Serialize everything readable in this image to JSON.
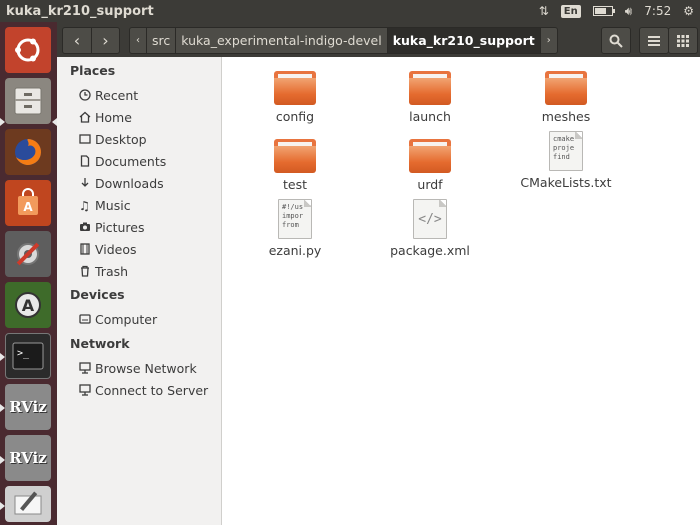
{
  "window": {
    "title": "kuka_kr210_support"
  },
  "top_panel": {
    "language": "En",
    "time": "7:52",
    "battery_level": 0.7
  },
  "launcher": {
    "items": [
      {
        "name": "dash-home",
        "icon": "ubuntu-logo-icon",
        "color": "#e95420"
      },
      {
        "name": "files",
        "icon": "file-cabinet-icon",
        "color": "#b7b5b0"
      },
      {
        "name": "firefox",
        "icon": "firefox-icon",
        "color": "#e66000"
      },
      {
        "name": "software-center",
        "icon": "shopping-bag-icon",
        "color": "#e95420"
      },
      {
        "name": "system-settings",
        "icon": "wrench-gear-icon",
        "color": "#9a9a9a"
      },
      {
        "name": "update-manager",
        "icon": "update-icon",
        "color": "#5a8f3a"
      },
      {
        "name": "terminal",
        "icon": "terminal-icon",
        "color": "#2b2b2b"
      },
      {
        "name": "rviz-1",
        "icon": "rviz-icon",
        "label": "RViz",
        "color": "#8c8c8c"
      },
      {
        "name": "rviz-2",
        "icon": "rviz-icon",
        "label": "RViz",
        "color": "#8c8c8c"
      },
      {
        "name": "text-editor",
        "icon": "pencil-icon",
        "color": "#cfcfcf"
      }
    ]
  },
  "toolbar": {
    "breadcrumbs": [
      {
        "label": "src",
        "active": false
      },
      {
        "label": "kuka_experimental-indigo-devel",
        "active": false
      },
      {
        "label": "kuka_kr210_support",
        "active": true
      }
    ]
  },
  "sidebar": {
    "places_title": "Places",
    "places": [
      {
        "label": "Recent",
        "icon": "clock-icon"
      },
      {
        "label": "Home",
        "icon": "home-icon"
      },
      {
        "label": "Desktop",
        "icon": "folder-icon"
      },
      {
        "label": "Documents",
        "icon": "document-icon"
      },
      {
        "label": "Downloads",
        "icon": "download-icon"
      },
      {
        "label": "Music",
        "icon": "music-note-icon"
      },
      {
        "label": "Pictures",
        "icon": "camera-icon"
      },
      {
        "label": "Videos",
        "icon": "film-icon"
      },
      {
        "label": "Trash",
        "icon": "trash-icon"
      }
    ],
    "devices_title": "Devices",
    "devices": [
      {
        "label": "Computer",
        "icon": "drive-icon"
      }
    ],
    "network_title": "Network",
    "network": [
      {
        "label": "Browse Network",
        "icon": "network-icon"
      },
      {
        "label": "Connect to Server",
        "icon": "server-icon"
      }
    ]
  },
  "files": [
    {
      "name": "config",
      "type": "folder"
    },
    {
      "name": "launch",
      "type": "folder"
    },
    {
      "name": "meshes",
      "type": "folder"
    },
    {
      "name": "test",
      "type": "folder"
    },
    {
      "name": "urdf",
      "type": "folder"
    },
    {
      "name": "CMakeLists.txt",
      "type": "text",
      "preview": [
        "cmake",
        "proje",
        "",
        "find"
      ]
    },
    {
      "name": "ezani.py",
      "type": "text",
      "preview": [
        "#!/us",
        "",
        "impor",
        "from"
      ]
    },
    {
      "name": "package.xml",
      "type": "xml",
      "preview": [
        "</>"
      ]
    }
  ]
}
